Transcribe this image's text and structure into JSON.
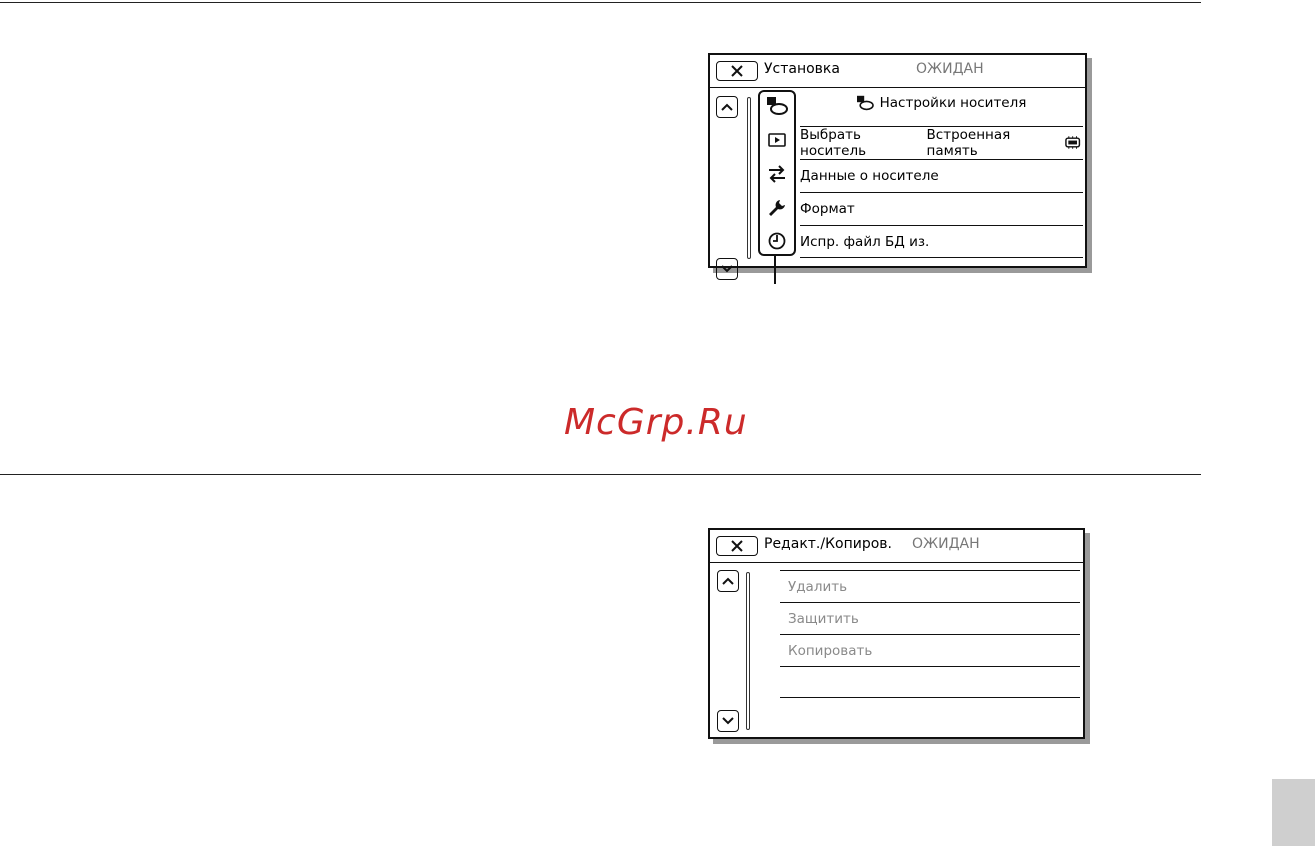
{
  "watermark": "McGrp.Ru",
  "setup_screen": {
    "title": "Установка",
    "status": "ОЖИДАН",
    "header_label": "Настройки носителя",
    "categories": [
      {
        "icon": "media-settings-icon"
      },
      {
        "icon": "playback-icon"
      },
      {
        "icon": "connection-icon"
      },
      {
        "icon": "general-settings-icon"
      },
      {
        "icon": "clock-settings-icon"
      }
    ],
    "items": [
      {
        "label": "Выбрать носитель",
        "value": "Встроенная память"
      },
      {
        "label": "Данные о носителе",
        "value": ""
      },
      {
        "label": "Формат",
        "value": ""
      },
      {
        "label": "Испр. файл БД из.",
        "value": ""
      }
    ]
  },
  "edit_screen": {
    "title": "Редакт./Копиров.",
    "status": "ОЖИДАН",
    "items": [
      {
        "label": "Удалить"
      },
      {
        "label": "Защитить"
      },
      {
        "label": "Копировать"
      },
      {
        "label": ""
      }
    ]
  }
}
